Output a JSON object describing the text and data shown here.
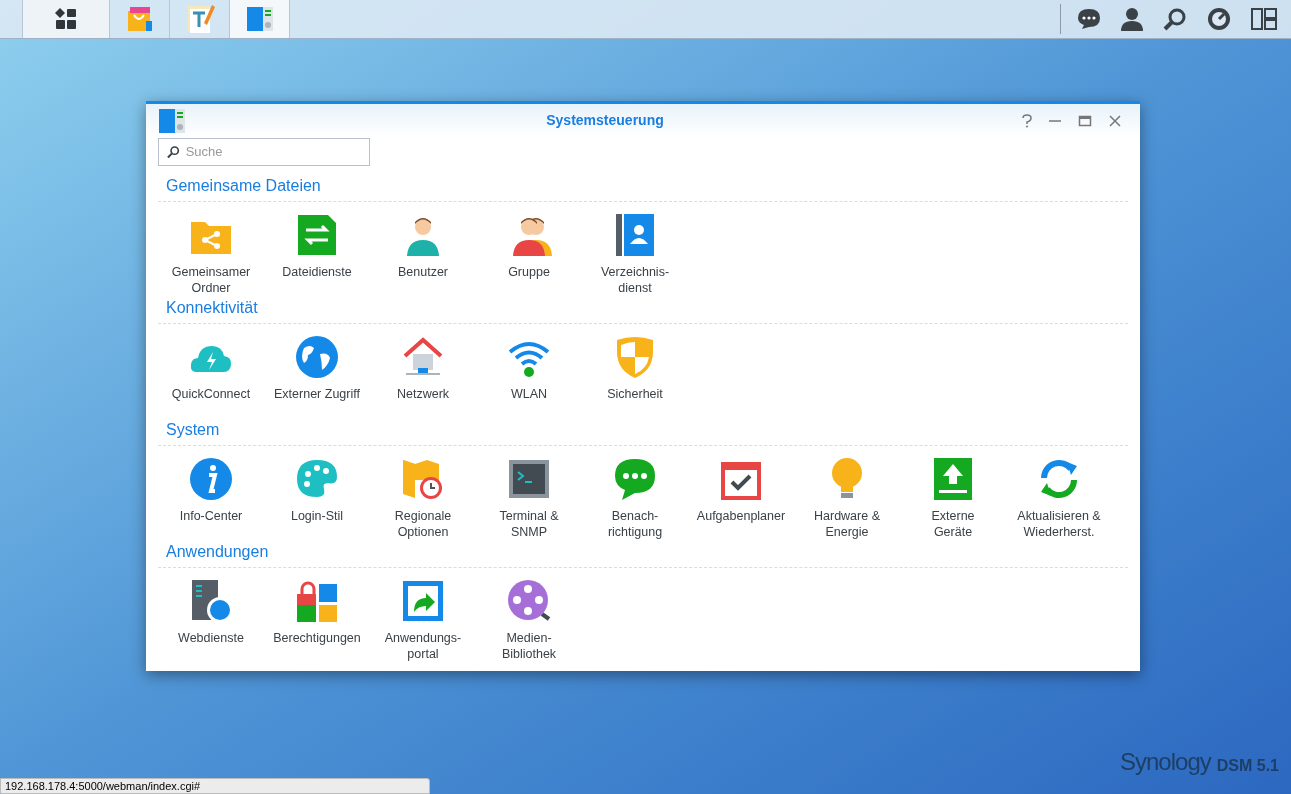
{
  "taskbar": {
    "apps": [
      {
        "selected": false
      },
      {
        "selected": false
      },
      {
        "selected": true
      }
    ]
  },
  "window": {
    "title": "Systemsteuerung",
    "search": {
      "placeholder": "Suche"
    },
    "sections": [
      {
        "title": "Gemeinsame Dateien",
        "items": [
          "Gemeinsamer\nOrdner",
          "Dateidienste",
          "Benutzer",
          "Gruppe",
          "Verzeichnis-\ndienst"
        ]
      },
      {
        "title": "Konnektivität",
        "items": [
          "QuickConnect",
          "Externer Zugriff",
          "Netzwerk",
          "WLAN",
          "Sicherheit"
        ]
      },
      {
        "title": "System",
        "items": [
          "Info-Center",
          "Login-Stil",
          "Regionale\nOptionen",
          "Terminal &\nSNMP",
          "Benach-\nrichtigung",
          "Aufgabenplaner",
          "Hardware &\nEnergie",
          "Externe\nGeräte",
          "Aktualisieren &\nWiederherst."
        ]
      },
      {
        "title": "Anwendungen",
        "items": [
          "Webdienste",
          "Berechtigungen",
          "Anwendungs-\nportal",
          "Medien-\nBibliothek"
        ]
      }
    ]
  },
  "status_bar": {
    "url": "192.168.178.4:5000/webman/index.cgi#"
  },
  "wallpaper": {
    "brand": "Synology",
    "version": "DSM 5.1"
  }
}
